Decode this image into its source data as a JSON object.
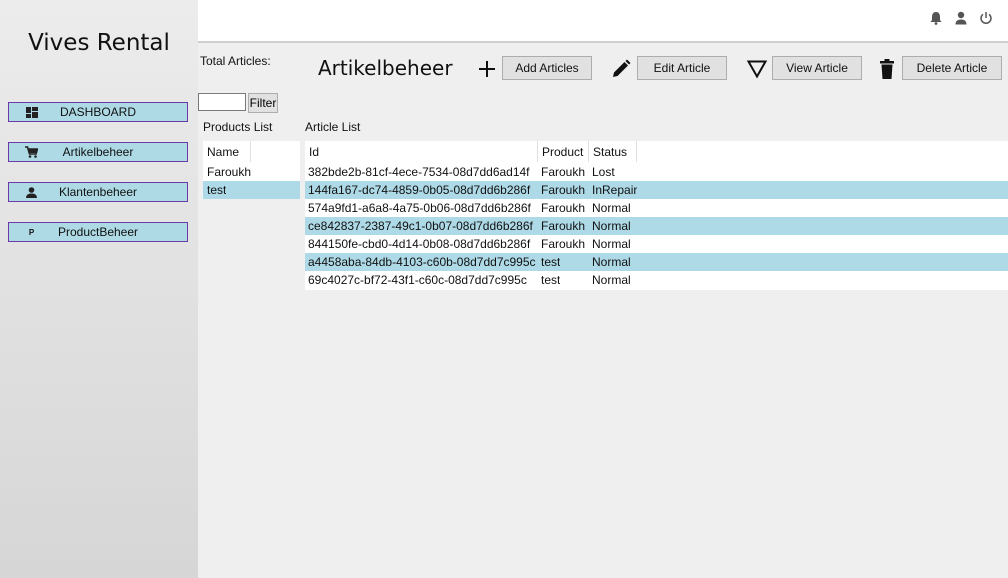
{
  "sidebar": {
    "title": "Vives Rental",
    "items": [
      {
        "label": "DASHBOARD",
        "icon": "dashboard-icon"
      },
      {
        "label": "Artikelbeheer",
        "icon": "cart-icon"
      },
      {
        "label": "Klantenbeheer",
        "icon": "person-icon"
      },
      {
        "label": "ProductBeheer",
        "icon": "p-icon",
        "icon_text": "P"
      }
    ]
  },
  "topbar": {
    "icons": [
      "bell-icon",
      "user-icon",
      "power-icon"
    ]
  },
  "main": {
    "total_label": "Total Articles:",
    "title": "Artikelbeheer",
    "toolbar": {
      "add_label": "Add Articles",
      "edit_label": "Edit Article",
      "view_label": "View Article",
      "delete_label": "Delete Article"
    },
    "filter": {
      "value": "",
      "button_label": "Filter"
    },
    "products_list": {
      "label": "Products List",
      "header": "Name",
      "rows": [
        {
          "name": "Faroukh",
          "selected": false
        },
        {
          "name": "test",
          "selected": true
        }
      ]
    },
    "article_list": {
      "label": "Article List",
      "columns": [
        "Id",
        "Product",
        "Status"
      ],
      "rows": [
        {
          "id": "382bde2b-81cf-4ece-7534-08d7dd6ad14f",
          "product": "Faroukh",
          "status": "Lost",
          "selected": false
        },
        {
          "id": "144fa167-dc74-4859-0b05-08d7dd6b286f",
          "product": "Faroukh",
          "status": "InRepair",
          "selected": true
        },
        {
          "id": "574a9fd1-a6a8-4a75-0b06-08d7dd6b286f",
          "product": "Faroukh",
          "status": "Normal",
          "selected": false
        },
        {
          "id": "ce842837-2387-49c1-0b07-08d7dd6b286f",
          "product": "Faroukh",
          "status": "Normal",
          "selected": true
        },
        {
          "id": "844150fe-cbd0-4d14-0b08-08d7dd6b286f",
          "product": "Faroukh",
          "status": "Normal",
          "selected": false
        },
        {
          "id": "a4458aba-84db-4103-c60b-08d7dd7c995c",
          "product": "test",
          "status": "Normal",
          "selected": true
        },
        {
          "id": "69c4027c-bf72-43f1-c60c-08d7dd7c995c",
          "product": "test",
          "status": "Normal",
          "selected": false
        }
      ]
    }
  },
  "colors": {
    "selection": "#aed9e6",
    "nav_button": "#aedae6",
    "nav_border": "#6a3aa6"
  }
}
